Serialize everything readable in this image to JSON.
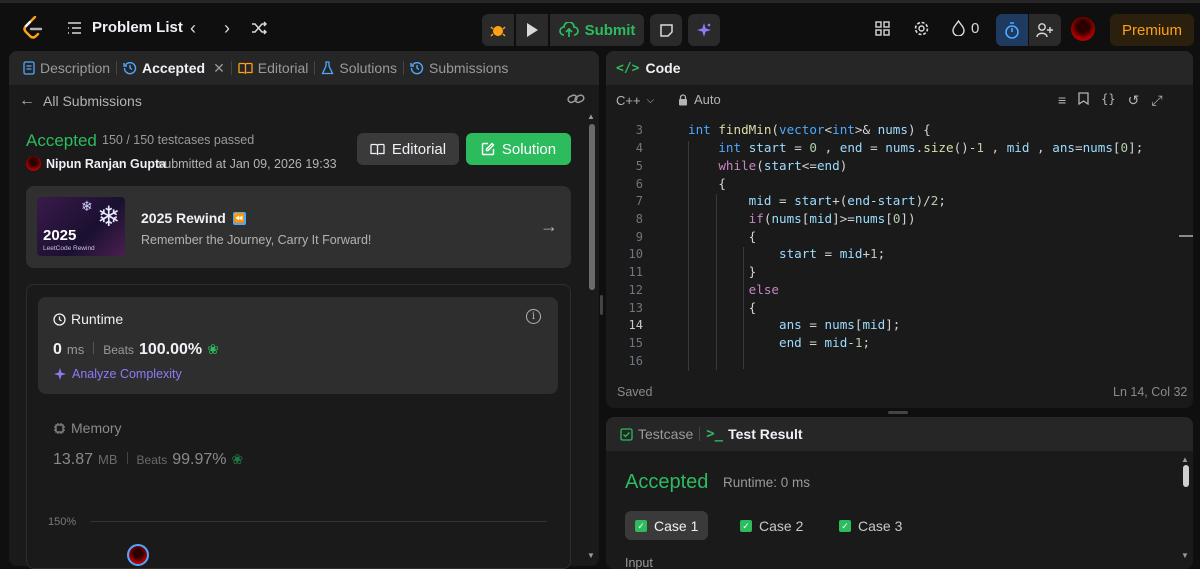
{
  "nav": {
    "problem_list": "Problem List",
    "submit": "Submit",
    "fire_count": "0",
    "premium": "Premium"
  },
  "left_tabs": [
    {
      "label": "Description"
    },
    {
      "label": "Accepted"
    },
    {
      "label": "Editorial"
    },
    {
      "label": "Solutions"
    },
    {
      "label": "Submissions"
    }
  ],
  "submission": {
    "back_label": "All Submissions",
    "status": "Accepted",
    "testcases": "150 / 150 testcases passed",
    "user": "Nipun Ranjan Gupta",
    "submitted_at": "submitted at Jan 09, 2026 19:33",
    "editorial_btn": "Editorial",
    "solution_btn": "Solution"
  },
  "rewind": {
    "year": "2025",
    "caption": "LeetCode Rewind",
    "title": "2025 Rewind",
    "subtitle": "Remember the Journey, Carry It Forward!"
  },
  "runtime": {
    "label": "Runtime",
    "value": "0",
    "unit": "ms",
    "beats_label": "Beats",
    "beats": "100.00%",
    "analyze": "Analyze Complexity"
  },
  "memory": {
    "label": "Memory",
    "value": "13.87",
    "unit": "MB",
    "beats_label": "Beats",
    "beats": "99.97%",
    "axis_label": "150%"
  },
  "code_panel": {
    "title": "Code",
    "language": "C++",
    "mode": "Auto",
    "saved": "Saved",
    "cursor": "Ln 14, Col 32",
    "line_numbers": [
      "3",
      "4",
      "5",
      "6",
      "7",
      "8",
      "9",
      "10",
      "11",
      "12",
      "13",
      "14",
      "15",
      "16"
    ]
  },
  "test_panel": {
    "tab_testcase": "Testcase",
    "tab_result": "Test Result",
    "status": "Accepted",
    "runtime": "Runtime: 0 ms",
    "cases": [
      "Case 1",
      "Case 2",
      "Case 3"
    ],
    "input_label": "Input"
  },
  "colors": {
    "accent_green": "#2cbb5d",
    "premium": "#ffa116",
    "link_blue": "#4fa8ff"
  }
}
